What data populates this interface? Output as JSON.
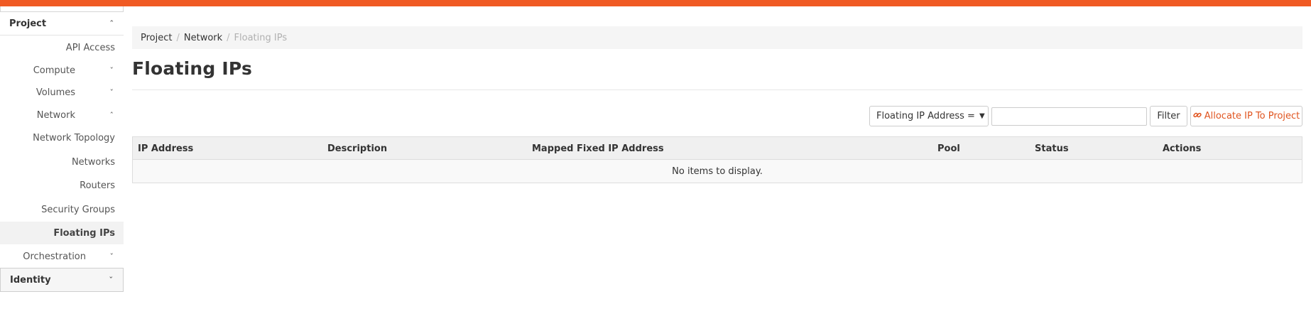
{
  "sidebar": {
    "project_label": "Project",
    "items": [
      {
        "label": "API Access"
      },
      {
        "label": "Compute"
      },
      {
        "label": "Volumes"
      },
      {
        "label": "Network"
      },
      {
        "label": "Network Topology"
      },
      {
        "label": "Networks"
      },
      {
        "label": "Routers"
      },
      {
        "label": "Security Groups"
      },
      {
        "label": "Floating IPs"
      },
      {
        "label": "Orchestration"
      }
    ],
    "identity_label": "Identity",
    "caret_up": "ˆ",
    "caret_down": "ˇ"
  },
  "breadcrumb": {
    "items": [
      "Project",
      "Network",
      "Floating IPs"
    ],
    "separator": "/"
  },
  "page": {
    "title": "Floating IPs"
  },
  "toolbar": {
    "filter_select_value": "Floating IP Address =",
    "filter_input_value": "",
    "filter_button": "Filter",
    "allocate_button": "Allocate IP To Project"
  },
  "table": {
    "columns": [
      "IP Address",
      "Description",
      "Mapped Fixed IP Address",
      "Pool",
      "Status",
      "Actions"
    ],
    "empty_message": "No items to display."
  },
  "colors": {
    "accent": "#f05a24",
    "link": "#e0541f"
  }
}
